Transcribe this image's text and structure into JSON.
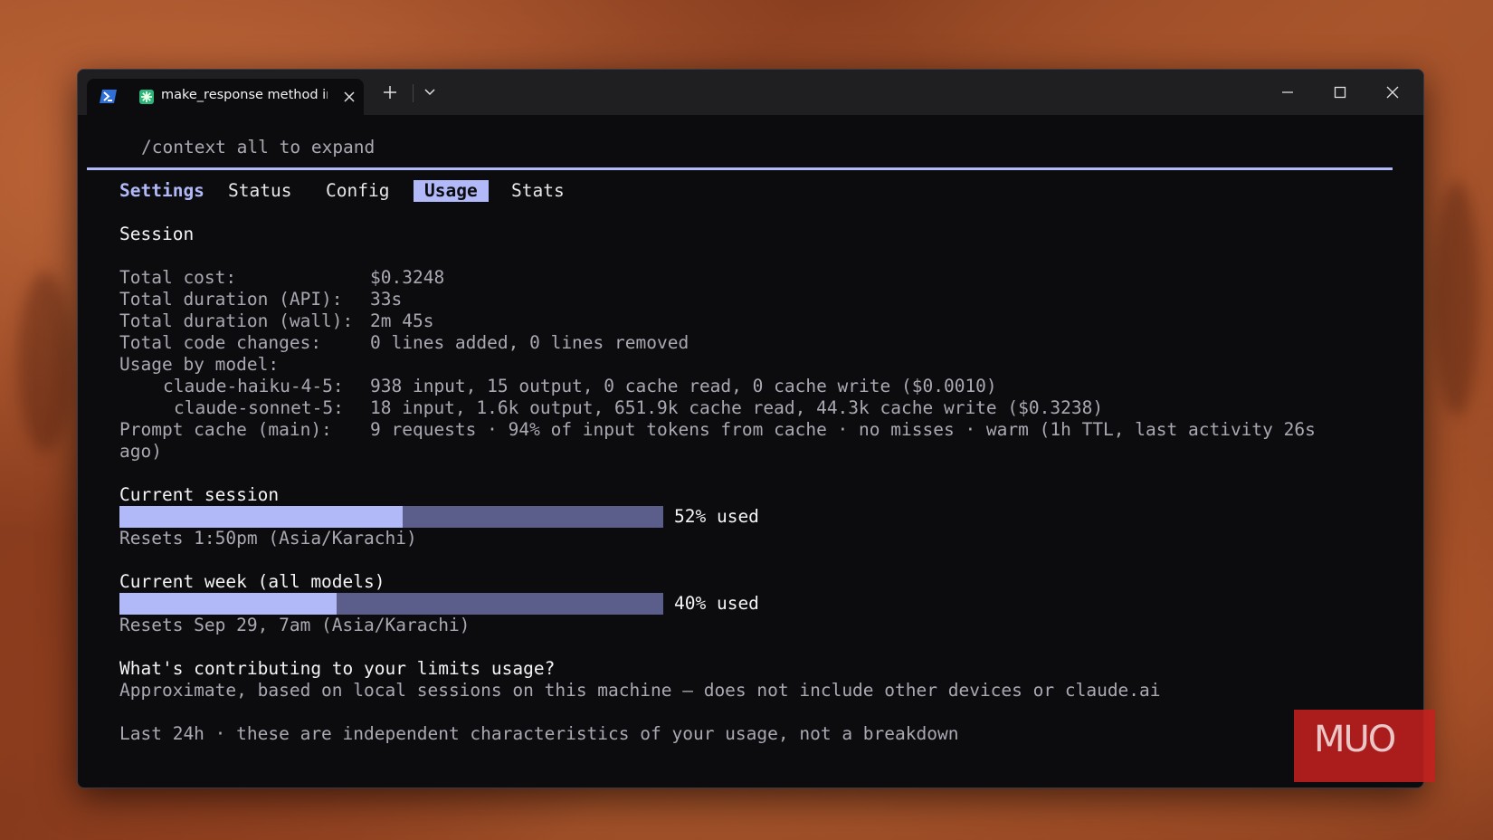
{
  "window": {
    "tab_title": "make_response method ir",
    "icons": [
      "powershell-icon",
      "claude-icon",
      "close-icon",
      "plus-icon",
      "chevron-down-icon",
      "minimize-icon",
      "maximize-icon",
      "close-window-icon"
    ]
  },
  "terminal": {
    "hint": "/context all to expand",
    "tabs": {
      "settings": "Settings",
      "status": "Status",
      "config": "Config",
      "usage": "Usage",
      "stats": "Stats"
    },
    "session_header": "Session",
    "rows": [
      {
        "label": "Total cost:",
        "value": "$0.3248"
      },
      {
        "label": "Total duration (API):",
        "value": "33s"
      },
      {
        "label": "Total duration (wall):",
        "value": "2m 45s"
      },
      {
        "label": "Total code changes:",
        "value": "0 lines added, 0 lines removed"
      }
    ],
    "usage_by_model_label": "Usage by model:",
    "models": [
      {
        "name": "claude-haiku-4-5:",
        "value": "938 input, 15 output, 0 cache read, 0 cache write ($0.0010)"
      },
      {
        "name": "claude-sonnet-5:",
        "value": "18 input, 1.6k output, 651.9k cache read, 44.3k cache write ($0.3238)"
      }
    ],
    "prompt_cache_label": "Prompt cache (main):",
    "prompt_cache_value": "9 requests · 94% of input tokens from cache · no misses · warm (1h TTL, last activity 26s",
    "prompt_cache_wrap": "ago)",
    "limits": [
      {
        "title": "Current session",
        "fraction": 0.52,
        "label": "52% used",
        "reset": "Resets 1:50pm (Asia/Karachi)"
      },
      {
        "title": "Current week (all models)",
        "fraction": 0.4,
        "label": "40% used",
        "reset": "Resets Sep 29, 7am (Asia/Karachi)"
      }
    ],
    "contrib_question": "What's contributing to your limits usage?",
    "contrib_note": "Approximate, based on local sessions on this machine — does not include other devices or claude.ai",
    "last24": "Last 24h · these are independent characteristics of your usage, not a breakdown"
  },
  "watermark": {
    "text": "MUO"
  },
  "colors": {
    "accent": "#b1b9f8",
    "bar_track": "#5b5e8a",
    "terminal_bg": "#0c0c0f"
  }
}
